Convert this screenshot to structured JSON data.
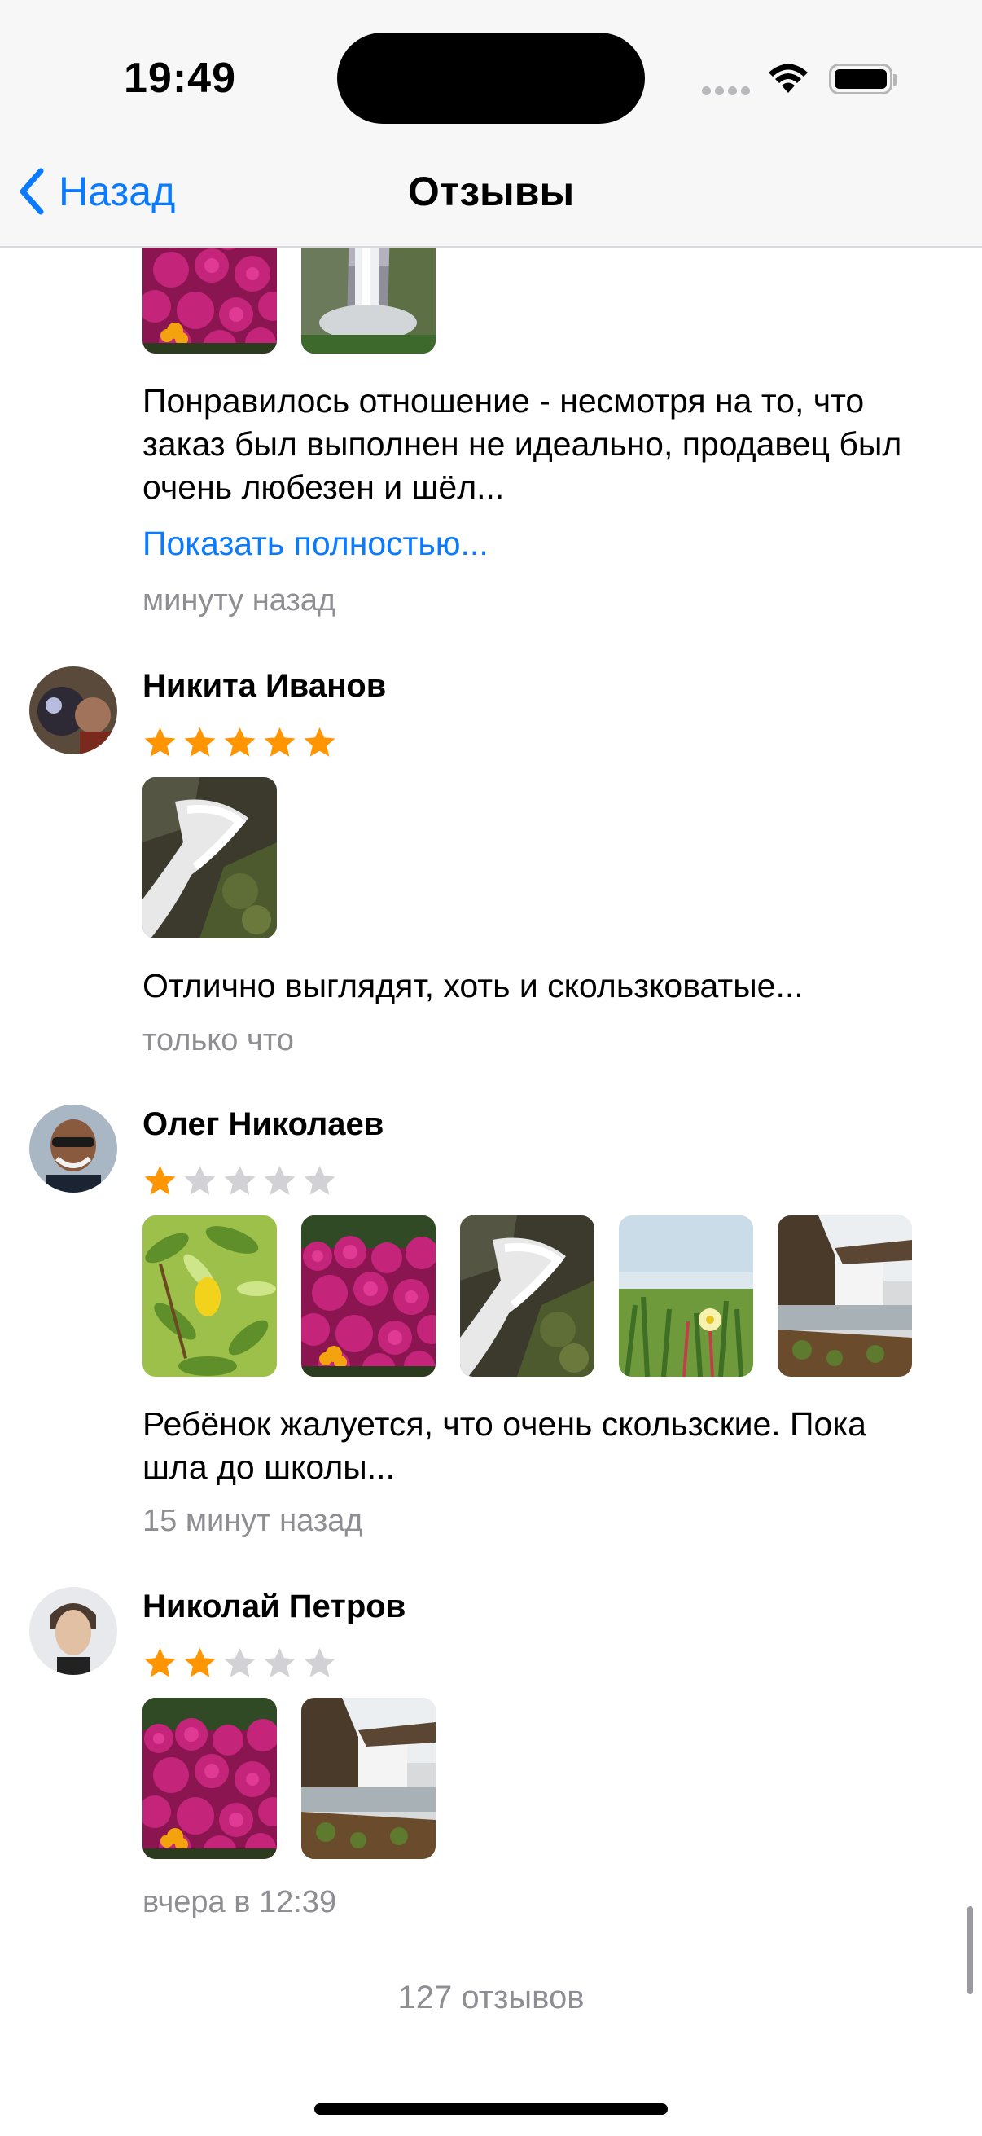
{
  "status": {
    "time": "19:49"
  },
  "nav": {
    "back_label": "Назад",
    "title": "Отзывы"
  },
  "colors": {
    "accent": "#0a7aff",
    "star_filled": "#ff9500",
    "star_empty": "#d1d1d6",
    "secondary_text": "#8e8e93"
  },
  "reviews": [
    {
      "author": "",
      "rating": null,
      "photos": [
        "flowers",
        "waterfall-valley"
      ],
      "text": "Понравилось отношение - несмотря на то, что заказ был выполнен не идеально, продавец был очень любезен и шёл...",
      "more_label": "Показать полностью...",
      "time": "минуту назад"
    },
    {
      "author": "Никита Иванов",
      "rating": 5,
      "photos": [
        "waterfall-rocks"
      ],
      "text": "Отлично выглядят, хоть и скользковатые...",
      "time": "только что"
    },
    {
      "author": "Олег Николаев",
      "rating": 1,
      "photos": [
        "lemon-tree",
        "flowers",
        "waterfall-rocks",
        "ice-plant-flower",
        "waterfall-cliff"
      ],
      "text": "Ребёнок жалуется, что очень скользские. Пока шла до школы...",
      "time": "15 минут назад"
    },
    {
      "author": "Николай Петров",
      "rating": 2,
      "photos": [
        "flowers",
        "waterfall-cliff"
      ],
      "text": "",
      "time": "вчера в 12:39"
    }
  ],
  "footer": {
    "count_label": "127 отзывов"
  }
}
